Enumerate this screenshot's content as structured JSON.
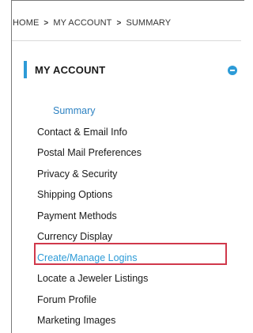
{
  "breadcrumb": {
    "items": [
      "HOME",
      "MY ACCOUNT",
      "SUMMARY"
    ],
    "separator": ">"
  },
  "section": {
    "title": "MY ACCOUNT",
    "collapse_icon": "minus-circle-icon"
  },
  "menu": {
    "items": [
      "Summary",
      "Contact & Email Info",
      "Postal Mail Preferences",
      "Privacy & Security",
      "Shipping Options",
      "Payment Methods",
      "Currency Display",
      "Create/Manage Logins",
      "Locate a Jeweler Listings",
      "Forum Profile",
      "Marketing Images"
    ]
  },
  "colors": {
    "accent": "#2d9bd7",
    "highlight": "#d0384b"
  }
}
